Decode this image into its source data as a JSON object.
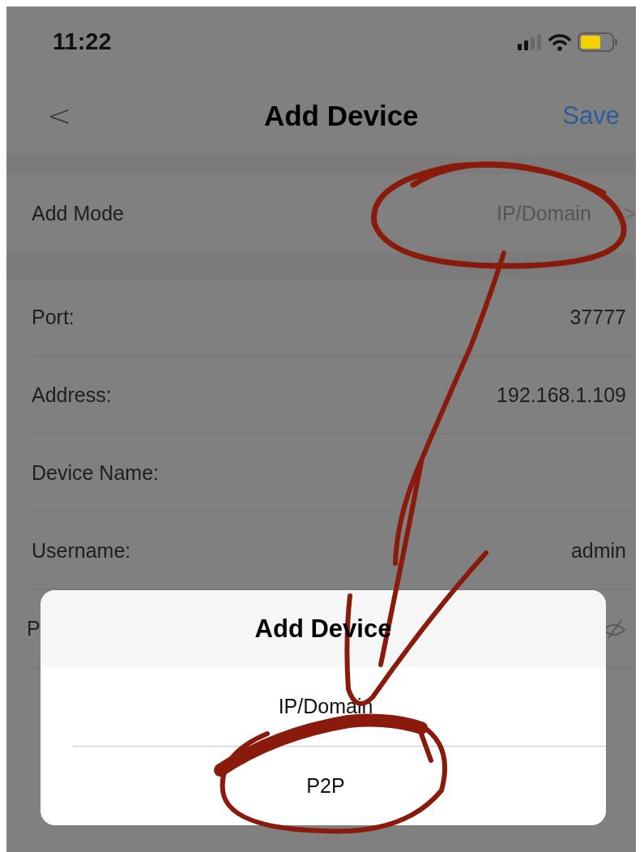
{
  "status_bar": {
    "time": "11:22"
  },
  "nav": {
    "back": "<",
    "title": "Add Device",
    "action": "Save"
  },
  "add_mode": {
    "label": "Add Mode",
    "value": "IP/Domain",
    "chevron": ">"
  },
  "fields": [
    {
      "kind": "text",
      "label": "Port:",
      "value": "37777"
    },
    {
      "kind": "text",
      "label": "Address:",
      "value": "192.168.1.109"
    },
    {
      "kind": "text",
      "label": "Device Name:"
    },
    {
      "kind": "text",
      "label": "Username:",
      "value": "admin"
    },
    {
      "kind": "password",
      "label": "P"
    }
  ],
  "sheet": {
    "title": "Add Device",
    "options": [
      "IP/Domain",
      "P2P"
    ]
  }
}
